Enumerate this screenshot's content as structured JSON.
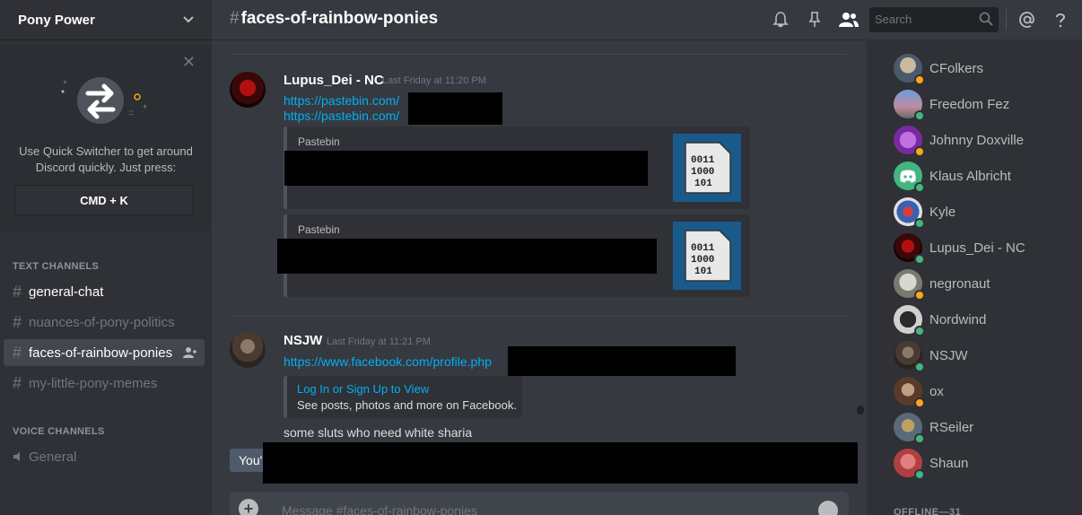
{
  "server": {
    "name": "Pony Power"
  },
  "quick_switcher": {
    "text_line1": "Use Quick Switcher to get around",
    "text_line2": "Discord quickly. Just press:",
    "shortcut": "CMD + K"
  },
  "sidebar": {
    "text_channels_label": "TEXT CHANNELS",
    "channels": [
      {
        "name": "general-chat"
      },
      {
        "name": "nuances-of-pony-politics"
      },
      {
        "name": "faces-of-rainbow-ponies"
      },
      {
        "name": "my-little-pony-memes"
      }
    ],
    "voice_channels_label": "VOICE CHANNELS",
    "voice_channels": [
      {
        "name": "General"
      }
    ]
  },
  "header": {
    "channel": "faces-of-rainbow-ponies",
    "search_placeholder": "Search"
  },
  "messages": [
    {
      "author": "Lupus_Dei - NC",
      "timestamp": "Last Friday at 11:20 PM",
      "links": [
        "https://pastebin.com/",
        "https://pastebin.com/"
      ],
      "embeds": [
        {
          "provider": "Pastebin"
        },
        {
          "provider": "Pastebin"
        }
      ]
    },
    {
      "author": "NSJW",
      "timestamp": "Last Friday at 11:21 PM",
      "link": "https://www.facebook.com/profile.php",
      "embed_title": "Log In or Sign Up to View",
      "embed_desc": "See posts, photos and more on Facebook.",
      "text": "some sluts who need white sharia"
    }
  ],
  "new_messages_stub": "You'",
  "composer": {
    "placeholder": "Message #faces-of-rainbow-ponies"
  },
  "members": [
    {
      "name": "CFolkers",
      "status_color": "#faa61a"
    },
    {
      "name": "Freedom Fez",
      "status_color": "#43b581"
    },
    {
      "name": "Johnny Doxville",
      "status_color": "#faa61a"
    },
    {
      "name": "Klaus Albricht",
      "status_color": "#43b581"
    },
    {
      "name": "Kyle",
      "status_color": "#43b581"
    },
    {
      "name": "Lupus_Dei - NC",
      "status_color": "#43b581"
    },
    {
      "name": "negronaut",
      "status_color": "#faa61a"
    },
    {
      "name": "Nordwind",
      "status_color": "#43b581"
    },
    {
      "name": "NSJW",
      "status_color": "#43b581"
    },
    {
      "name": "ox",
      "status_color": "#faa61a"
    },
    {
      "name": "RSeiler",
      "status_color": "#43b581"
    },
    {
      "name": "Shaun",
      "status_color": "#43b581"
    }
  ],
  "offline_label": "OFFLINE—31"
}
